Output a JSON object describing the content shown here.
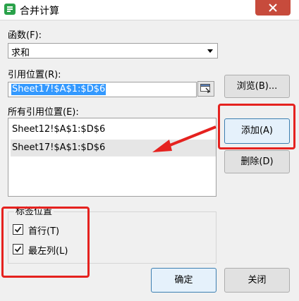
{
  "window": {
    "title": "合并计算"
  },
  "function": {
    "label": "函数(F):",
    "selected": "求和"
  },
  "reference": {
    "label": "引用位置(R):",
    "value": "Sheet17!$A$1:$D$6"
  },
  "all_references": {
    "label": "所有引用位置(E):",
    "items": [
      "Sheet12!$A$1:$D$6",
      "Sheet17!$A$1:$D$6"
    ]
  },
  "buttons": {
    "browse": "浏览(B)...",
    "add": "添加(A)",
    "delete": "删除(D)",
    "ok": "确定",
    "close": "关闭"
  },
  "label_position": {
    "title": "标签位置",
    "top_row": {
      "label": "首行(T)",
      "checked": true
    },
    "left_column": {
      "label": "最左列(L)",
      "checked": true
    }
  },
  "annotations": {
    "highlight_color": "#e5221f"
  }
}
